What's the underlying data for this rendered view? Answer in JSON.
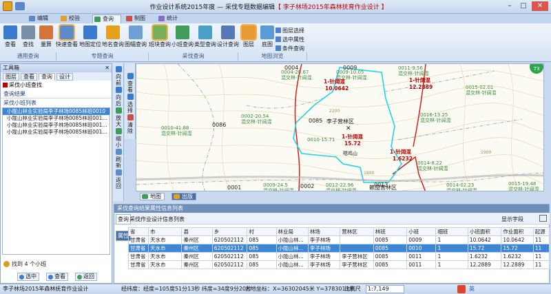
{
  "title": {
    "prefix": "作业设计系统2015年度 — 采伐专题数据编辑",
    "highlight": "【 李子林场2015年森林抚育作业设计 】"
  },
  "tabs": [
    {
      "label": "编辑"
    },
    {
      "label": "校验"
    },
    {
      "label": "查询"
    },
    {
      "label": "制图"
    },
    {
      "label": "统计"
    }
  ],
  "ribbon": {
    "buttons": [
      "查看",
      "查找",
      "量算",
      "快速查看",
      "地图定位",
      "地名查询",
      "图幅查询",
      "班块查询",
      "小班查询",
      "类型查询",
      "设计查询",
      "图层",
      "底图"
    ],
    "groups": [
      "通用查询",
      "专题查询",
      "采伐查询",
      "地图浏览"
    ],
    "small": [
      "图层选择",
      "选中属性",
      "条件查询"
    ]
  },
  "toolbox": {
    "title": "工具箱",
    "tabs": [
      "图层",
      "查看",
      "查询",
      "设计"
    ],
    "heading": "采伐小班查找",
    "result_label": "查询结果",
    "list_label": "采伐小班列表",
    "items": [
      "小陇山林业实验局李子林场0085林班0010",
      "小陇山林业实验局李子林场0085林班001...",
      "小陇山林业实验局李子林场0085林班001...",
      "小陇山林业实验局李子林场0085林班001..."
    ],
    "found": "找到 4 个小班",
    "buttons": [
      "选中",
      "查看",
      "返回"
    ]
  },
  "vstrip1": [
    "向前",
    "向后",
    "放大",
    "缩小",
    "刷新",
    "返回"
  ],
  "vstrip2": [
    "查看",
    "选择",
    "清除"
  ],
  "map": {
    "compartments": [
      "0004",
      "0009",
      "0011",
      "0086",
      "0085",
      "0001",
      "0002",
      "0013"
    ],
    "stand_labels": [
      {
        "id": "0004-20.67",
        "type": "混交林-针阔混"
      },
      {
        "id": "0009-10.05",
        "type": "混交林-针阔混"
      },
      {
        "id": "0011-9.56",
        "type": "混交林-针阔混"
      },
      {
        "id": "0002-20.54",
        "type": "混交林-针阔混"
      },
      {
        "id": "0010-41.88",
        "type": "混交林-针阔混"
      },
      {
        "id": "0010-15.71",
        "type": "1-针阔混"
      },
      {
        "id": "0016-13.25",
        "type": "混交林-针阔混"
      },
      {
        "id": "0015-02.01",
        "type": "混交林-针阔混"
      },
      {
        "id": "0014-8.22",
        "type": "混交林-针阔混"
      },
      {
        "id": "0009-24.5",
        "type": "混交林-针阔混"
      },
      {
        "id": "0012-22.96",
        "type": "混交林-针阔混"
      },
      {
        "id": "0014-02.23",
        "type": "混交林-针阔混"
      },
      {
        "id": "0015-19.48",
        "type": "混交林-针阔混"
      }
    ],
    "design_labels": [
      {
        "name": "1-针阔混",
        "value": "10.0642"
      },
      {
        "name": "1-针阔混",
        "value": "12.2889"
      },
      {
        "name": "1-针阔混",
        "value": "15.72"
      },
      {
        "name": "1-针阔混",
        "value": "1.6232"
      }
    ],
    "area_label": "李子营林区",
    "area_label2": "赖甜营林区",
    "place": "嗯鸡山",
    "contours": [
      "2200",
      "1800",
      "1900"
    ],
    "tabs": [
      "地图",
      "出版"
    ],
    "badge": "73"
  },
  "result": {
    "title": "采伐查询结果属性信息列表",
    "side_tabs": [
      "查询",
      "属性"
    ],
    "subtitle": "采伐作业设计信息列表",
    "show_fields": "显示字段",
    "headers": [
      "省",
      "市",
      "县",
      "乡",
      "村",
      "林业局",
      "林场",
      "营林区",
      "林班",
      "小班",
      "细班",
      "小班面积",
      "作业面积",
      "起源"
    ],
    "rows": [
      [
        "甘肃省",
        "天水市",
        "秦州区",
        "620502112",
        "085",
        "小陇山林...",
        "李子林场",
        "",
        "0085",
        "0009",
        "1",
        "10.0642",
        "10.0642",
        "11"
      ],
      [
        "甘肃省",
        "天水市",
        "秦州区",
        "620502112",
        "085",
        "小陇山林...",
        "李子林场",
        "",
        "0085",
        "0010",
        "1",
        "15.72",
        "15.72",
        "11"
      ],
      [
        "甘肃省",
        "天水市",
        "秦州区",
        "620502112",
        "085",
        "小陇山林...",
        "李子林场",
        "李子营林区",
        "0085",
        "0011",
        "1",
        "1.6232",
        "1.6232",
        "11"
      ],
      [
        "甘肃省",
        "天水市",
        "秦州区",
        "620502112",
        "085",
        "小陇山林...",
        "李子林场",
        "李子营林区",
        "0085",
        "0011",
        "1",
        "12.2889",
        "12.2889",
        "11"
      ]
    ]
  },
  "status": {
    "project": "李子林场2015年森林抚育作业设计",
    "coords": "经纬度：经度=105度51分13秒  纬度=34度9分20秒",
    "xy": "大地坐标：X=36302045米  Y=3783013米",
    "scale_label": "比例尺",
    "scale": "1:7,149",
    "ime": "英"
  }
}
